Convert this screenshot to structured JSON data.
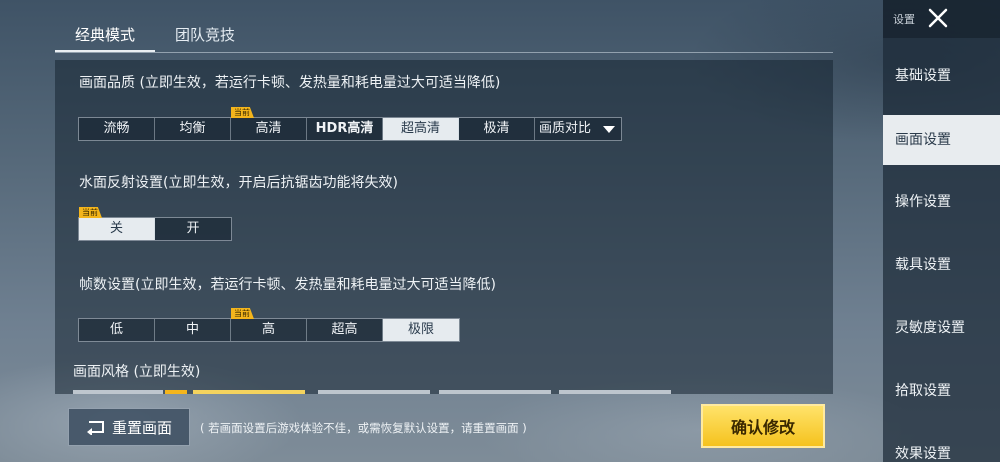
{
  "tabs": [
    {
      "label": "经典模式",
      "active": true
    },
    {
      "label": "团队竞技",
      "active": false
    }
  ],
  "sections": {
    "quality": {
      "title": "画面品质 (立即生效，若运行卡顿、发热量和耗电量过大可适当降低)",
      "options": [
        "流畅",
        "均衡",
        "高清",
        "HDR高清",
        "超高清",
        "极清"
      ],
      "dropdown": "画质对比",
      "selected": "超高清",
      "current": "高清"
    },
    "water": {
      "title": "水面反射设置(立即生效，开启后抗锯齿功能将失效)",
      "options": [
        "关",
        "开"
      ],
      "selected": "关",
      "current": "关"
    },
    "fps": {
      "title": "帧数设置(立即生效，若运行卡顿、发热量和耗电量过大可适当降低)",
      "options": [
        "低",
        "中",
        "高",
        "超高",
        "极限"
      ],
      "selected": "极限",
      "current": "高"
    },
    "style": {
      "title": "画面风格 (立即生效)"
    }
  },
  "badge_text": "当前",
  "bottom": {
    "reset_label": "重置画面",
    "hint": "( 若画面设置后游戏体验不佳，或需恢复默认设置，请重置画面 )",
    "confirm_label": "确认修改"
  },
  "sidebar": {
    "title": "设置",
    "items": [
      "基础设置",
      "画面设置",
      "操作设置",
      "载具设置",
      "灵敏度设置",
      "拾取设置",
      "效果设置"
    ],
    "active": "画面设置"
  },
  "colors": {
    "accent": "#f5c21e",
    "selected_bg": "#e6ebef"
  },
  "icons": {
    "close": "close-icon",
    "reset": "reset-icon",
    "caret": "caret-down-icon"
  }
}
